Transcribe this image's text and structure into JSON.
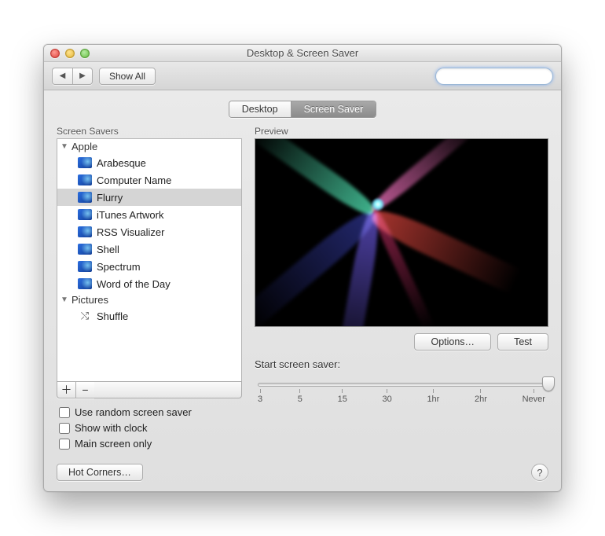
{
  "window": {
    "title": "Desktop & Screen Saver"
  },
  "toolbar": {
    "show_all": "Show All",
    "search_placeholder": ""
  },
  "tabs": {
    "desktop": "Desktop",
    "screensaver": "Screen Saver",
    "selected": "screensaver"
  },
  "source": {
    "title": "Screen Savers",
    "groups": [
      {
        "name": "Apple",
        "expanded": true,
        "items": [
          {
            "label": "Arabesque",
            "icon": "screensaver"
          },
          {
            "label": "Computer Name",
            "icon": "screensaver"
          },
          {
            "label": "Flurry",
            "icon": "screensaver",
            "selected": true
          },
          {
            "label": "iTunes Artwork",
            "icon": "screensaver"
          },
          {
            "label": "RSS Visualizer",
            "icon": "screensaver"
          },
          {
            "label": "Shell",
            "icon": "screensaver"
          },
          {
            "label": "Spectrum",
            "icon": "screensaver"
          },
          {
            "label": "Word of the Day",
            "icon": "screensaver"
          }
        ]
      },
      {
        "name": "Pictures",
        "expanded": true,
        "items": [
          {
            "label": "Shuffle",
            "icon": "shuffle"
          }
        ]
      }
    ],
    "add": "＋",
    "remove": "−"
  },
  "checks": {
    "random": "Use random screen saver",
    "clock": "Show with clock",
    "main": "Main screen only"
  },
  "preview": {
    "label": "Preview"
  },
  "buttons": {
    "options": "Options…",
    "test": "Test",
    "hot_corners": "Hot Corners…"
  },
  "slider": {
    "label": "Start screen saver:",
    "ticks": [
      "3",
      "5",
      "15",
      "30",
      "1hr",
      "2hr",
      "Never"
    ],
    "value_index": 6
  }
}
